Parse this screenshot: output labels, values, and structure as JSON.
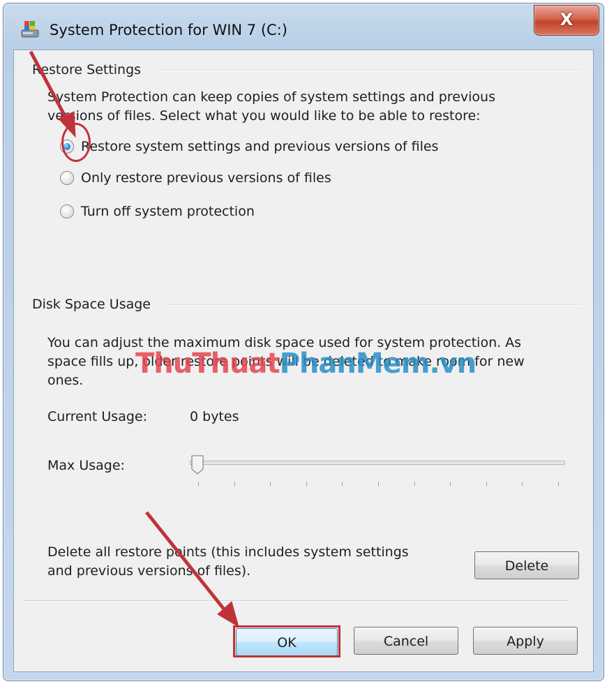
{
  "window": {
    "title": "System Protection for WIN 7 (C:)",
    "close_glyph": "X"
  },
  "restore_settings": {
    "heading": "Restore Settings",
    "description_line1": "System Protection can keep copies of system settings and previous",
    "description_line2": "versions of files. Select what you would like to be able to restore:",
    "options": [
      {
        "label": "Restore system settings and previous versions of files",
        "checked": true
      },
      {
        "label": "Only restore previous versions of files",
        "checked": false
      },
      {
        "label": "Turn off system protection",
        "checked": false
      }
    ]
  },
  "disk_space": {
    "heading": "Disk Space Usage",
    "description_line1": "You can adjust the maximum disk space used for system protection. As",
    "description_line2": "space fills up, older restore points will be deleted to make room for new",
    "description_line3": "ones.",
    "current_usage_label": "Current Usage:",
    "current_usage_value": "0 bytes",
    "max_usage_label": "Max Usage:",
    "max_usage_level": 0
  },
  "delete_section": {
    "text_line1": "Delete all restore points (this includes system settings",
    "text_line2": "and previous versions of files).",
    "delete_label": "Delete"
  },
  "footer": {
    "ok_label": "OK",
    "cancel_label": "Cancel",
    "apply_label": "Apply"
  },
  "watermark": {
    "part1": "ThuThuat",
    "part2": "PhanMem.vn"
  },
  "colors": {
    "annotation_red": "#c0323a",
    "watermark_red": "#e64650",
    "watermark_blue": "#2a90c8"
  }
}
